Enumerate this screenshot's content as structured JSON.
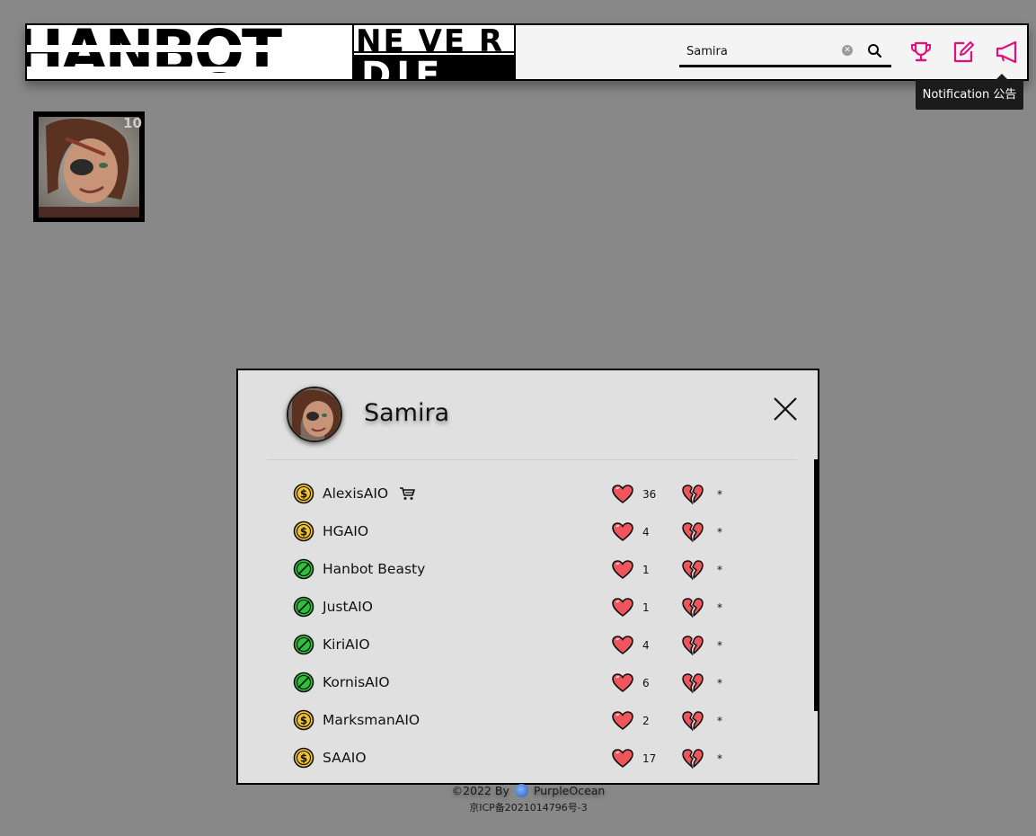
{
  "header": {
    "logo_main": "HANBOT",
    "logo_never": "NE VE R",
    "logo_die": "DIE",
    "search_value": "Samira",
    "icons": [
      "trophy-icon",
      "edit-icon",
      "megaphone-icon"
    ],
    "accent_color": "#e0107c",
    "tooltip": "Notification 公告"
  },
  "champion_tile": {
    "badge": "10"
  },
  "modal": {
    "title": "Samira",
    "rows": [
      {
        "name": "AlexisAIO",
        "type": "paid",
        "cart": true,
        "likes": "36",
        "dislikes": "*"
      },
      {
        "name": "HGAIO",
        "type": "paid",
        "cart": false,
        "likes": "4",
        "dislikes": "*"
      },
      {
        "name": "Hanbot Beasty",
        "type": "free",
        "cart": false,
        "likes": "1",
        "dislikes": "*"
      },
      {
        "name": "JustAIO",
        "type": "free",
        "cart": false,
        "likes": "1",
        "dislikes": "*"
      },
      {
        "name": "KiriAIO",
        "type": "free",
        "cart": false,
        "likes": "4",
        "dislikes": "*"
      },
      {
        "name": "KornisAIO",
        "type": "free",
        "cart": false,
        "likes": "6",
        "dislikes": "*"
      },
      {
        "name": "MarksmanAIO",
        "type": "paid",
        "cart": false,
        "likes": "2",
        "dislikes": "*"
      },
      {
        "name": "SAAIO",
        "type": "paid",
        "cart": false,
        "likes": "17",
        "dislikes": "*"
      }
    ]
  },
  "footer": {
    "copyright_prefix": "©2022 By",
    "author": "PurpleOcean",
    "icp": "京ICP备2021014796号-3"
  }
}
